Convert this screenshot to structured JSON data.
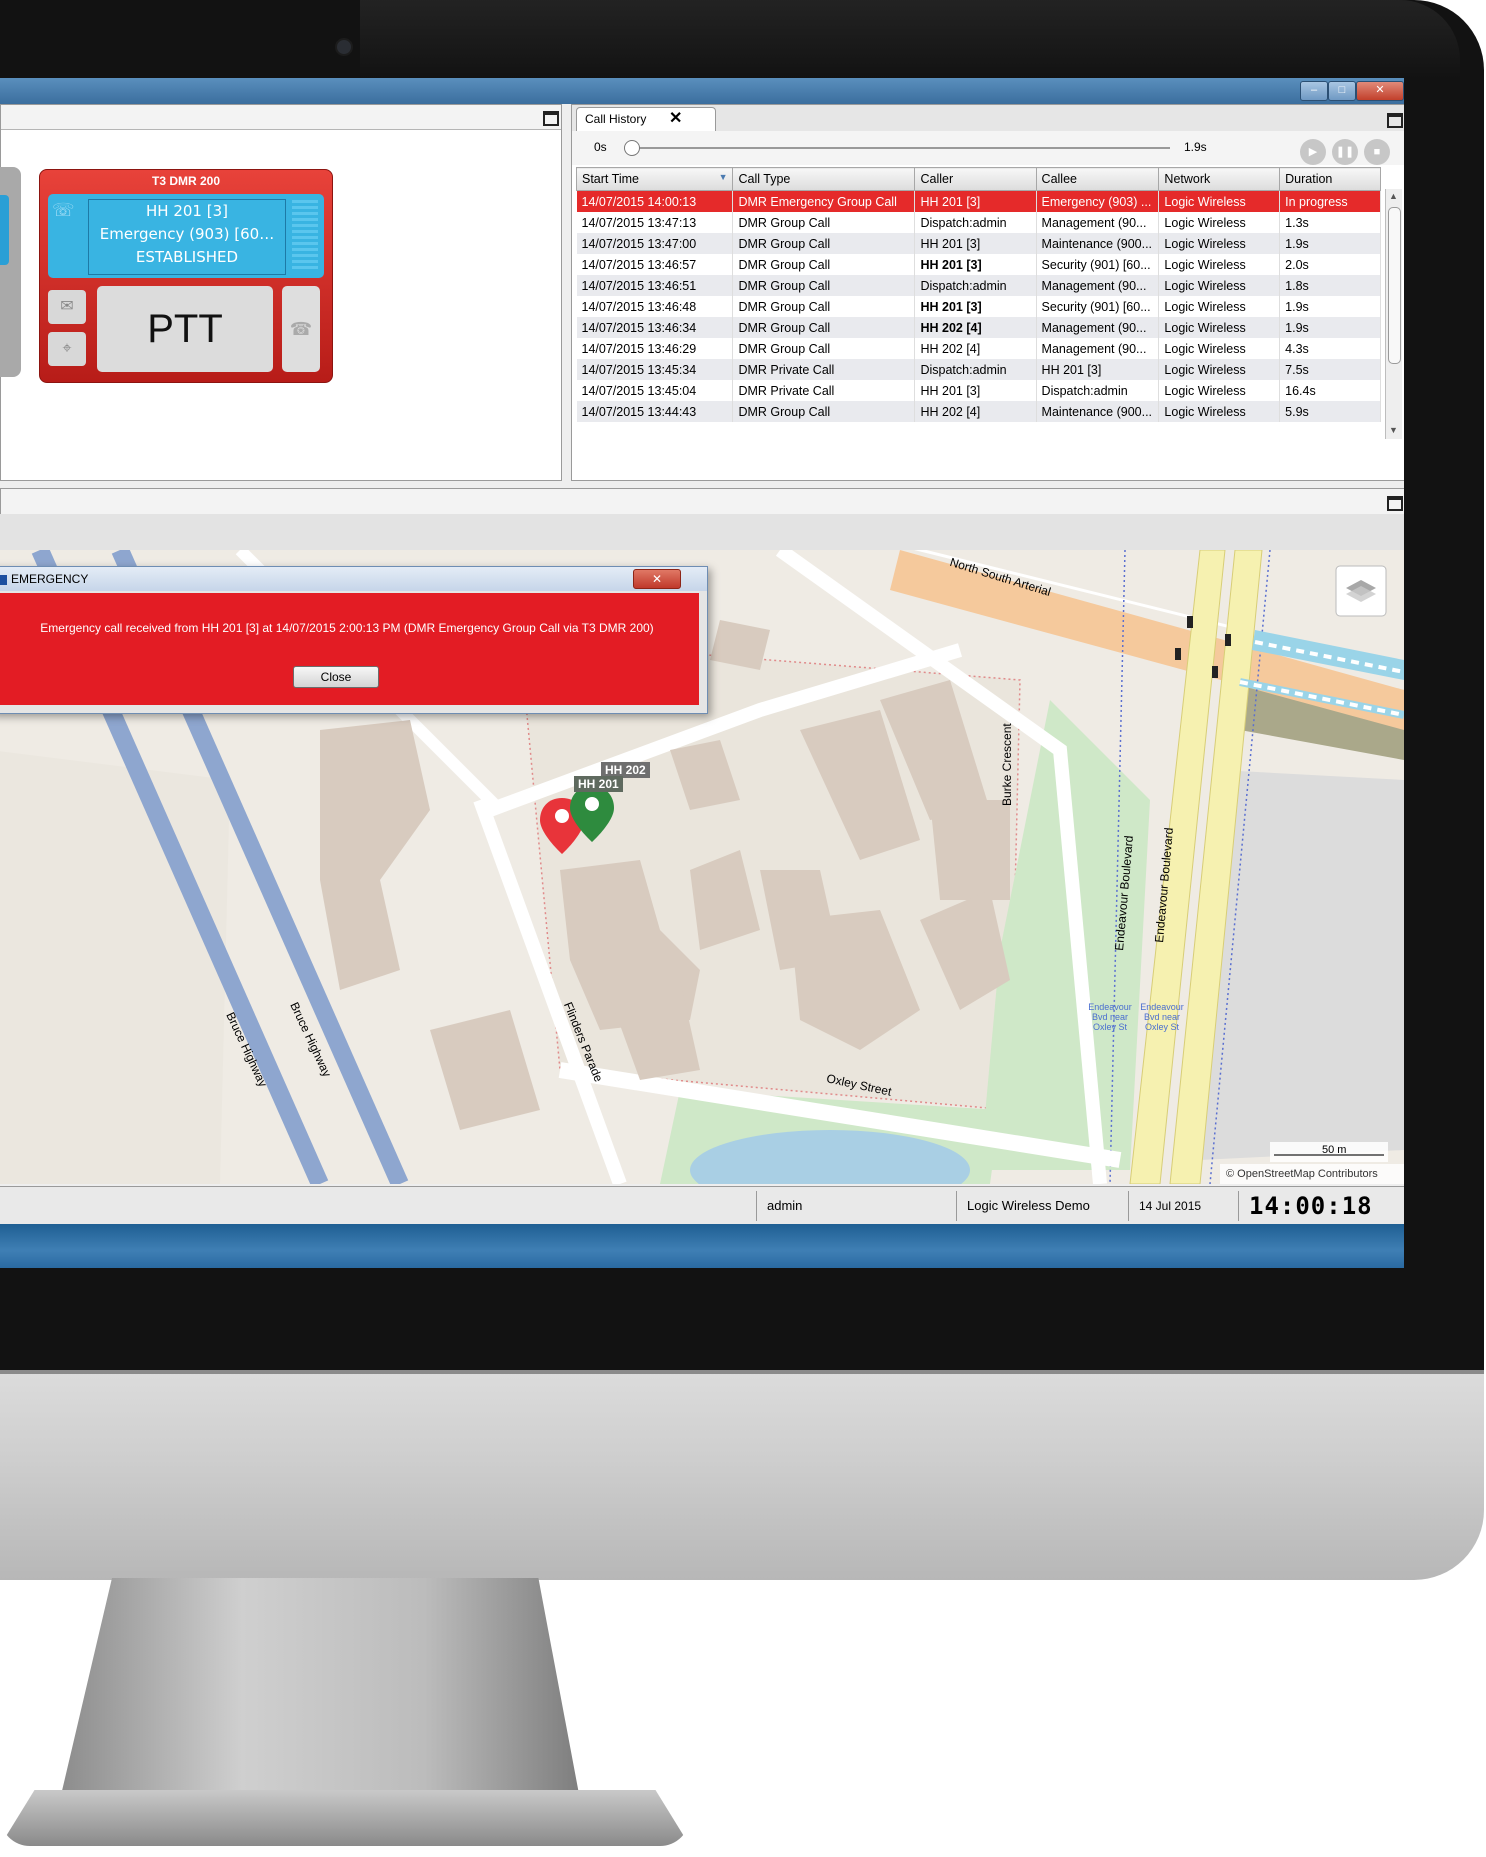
{
  "window": {
    "buttons": {
      "minimize": "–",
      "maximize": "□",
      "close": "✕"
    }
  },
  "radio_card": {
    "title": "T3 DMR 200",
    "line1": "HH 201 [3]",
    "line2": "Emergency (903) [60…",
    "line3": "ESTABLISHED",
    "ptt_label": "PTT",
    "color": "#e8423a",
    "screen_color": "#39b4e2"
  },
  "call_history": {
    "tab_label": "Call History",
    "tab_close": "✕",
    "slider_start": "0s",
    "slider_end": "1.9s",
    "columns": [
      "Start Time",
      "Call Type",
      "Caller",
      "Callee",
      "Network",
      "Duration"
    ],
    "rows": [
      {
        "start": "14/07/2015 14:00:13",
        "type": "DMR Emergency Group Call",
        "caller": "HH 201 [3]",
        "callee": "Emergency (903) ...",
        "network": "Logic Wireless",
        "duration": "In progress",
        "emergency": true
      },
      {
        "start": "14/07/2015 13:47:13",
        "type": "DMR Group Call",
        "caller": "Dispatch:admin",
        "callee": "Management (90...",
        "network": "Logic Wireless",
        "duration": "1.3s"
      },
      {
        "start": "14/07/2015 13:47:00",
        "type": "DMR Group Call",
        "caller": "HH 201 [3]",
        "callee": "Maintenance (900...",
        "network": "Logic Wireless",
        "duration": "1.9s"
      },
      {
        "start": "14/07/2015 13:46:57",
        "type": "DMR Group Call",
        "caller": "HH 201 [3]",
        "callee": "Security (901) [60...",
        "network": "Logic Wireless",
        "duration": "2.0s",
        "bold_caller": true
      },
      {
        "start": "14/07/2015 13:46:51",
        "type": "DMR Group Call",
        "caller": "Dispatch:admin",
        "callee": "Management (90...",
        "network": "Logic Wireless",
        "duration": "1.8s"
      },
      {
        "start": "14/07/2015 13:46:48",
        "type": "DMR Group Call",
        "caller": "HH 201 [3]",
        "callee": "Security (901) [60...",
        "network": "Logic Wireless",
        "duration": "1.9s",
        "bold_caller": true
      },
      {
        "start": "14/07/2015 13:46:34",
        "type": "DMR Group Call",
        "caller": "HH 202 [4]",
        "callee": "Management (90...",
        "network": "Logic Wireless",
        "duration": "1.9s",
        "bold_caller": true
      },
      {
        "start": "14/07/2015 13:46:29",
        "type": "DMR Group Call",
        "caller": "HH 202 [4]",
        "callee": "Management (90...",
        "network": "Logic Wireless",
        "duration": "4.3s"
      },
      {
        "start": "14/07/2015 13:45:34",
        "type": "DMR Private Call",
        "caller": "Dispatch:admin",
        "callee": "HH 201 [3]",
        "network": "Logic Wireless",
        "duration": "7.5s"
      },
      {
        "start": "14/07/2015 13:45:04",
        "type": "DMR Private Call",
        "caller": "HH 201 [3]",
        "callee": "Dispatch:admin",
        "network": "Logic Wireless",
        "duration": "16.4s"
      },
      {
        "start": "14/07/2015 13:44:43",
        "type": "DMR Group Call",
        "caller": "HH 202 [4]",
        "callee": "Maintenance (900...",
        "network": "Logic Wireless",
        "duration": "5.9s"
      }
    ],
    "emergency_row_color": "#e52a2a"
  },
  "emergency_dialog": {
    "title": "EMERGENCY",
    "close_x": "✕",
    "message": "Emergency call received from HH 201 [3] at 14/07/2015 2:00:13 PM (DMR Emergency Group Call via T3 DMR 200)",
    "button": "Close",
    "color": "#e31c24"
  },
  "map": {
    "streets": [
      "North South Arterial",
      "Burke Crescent",
      "Endeavour Boulevard",
      "Endeavour Boulevard",
      "Bruce Highway",
      "Bruce Highway",
      "Flinders Parade",
      "Oxley Street"
    ],
    "stop_labels": [
      "Endeavour Bvd near Oxley St",
      "Endeavour Bvd near Oxley St"
    ],
    "markers": [
      {
        "label": "HH 201",
        "color": "#e8343a"
      },
      {
        "label": "HH 202",
        "color": "#2e8b3e"
      }
    ],
    "scale_label": "50 m",
    "attribution": "© OpenStreetMap Contributors"
  },
  "status_bar": {
    "user": "admin",
    "system": "Logic Wireless Demo",
    "date": "14 Jul 2015",
    "clock": "14:00:18"
  }
}
